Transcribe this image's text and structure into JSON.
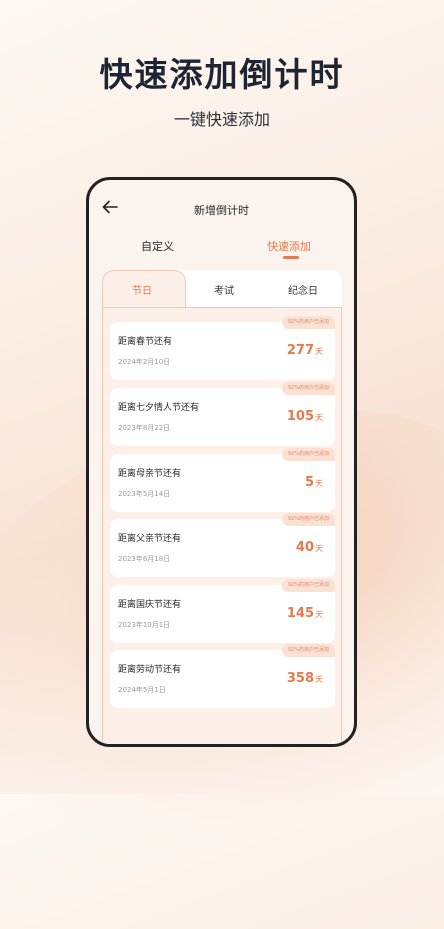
{
  "headline": "快速添加倒计时",
  "subhead": "一键快速添加",
  "nav": {
    "title": "新增倒计时",
    "back_icon": "arrow-left-icon"
  },
  "mode_tabs": [
    {
      "label": "自定义",
      "active": false
    },
    {
      "label": "快速添加",
      "active": true
    }
  ],
  "category_tabs": [
    {
      "label": "节日",
      "active": true
    },
    {
      "label": "考试",
      "active": false
    },
    {
      "label": "纪念日",
      "active": false
    }
  ],
  "items": [
    {
      "title": "距离春节还有",
      "date": "2024年2月10日",
      "days": "277",
      "unit": "天",
      "badge": "92%的用户已添加"
    },
    {
      "title": "距离七夕情人节还有",
      "date": "2023年8月22日",
      "days": "105",
      "unit": "天",
      "badge": "92%的用户已添加"
    },
    {
      "title": "距离母亲节还有",
      "date": "2023年5月14日",
      "days": "5",
      "unit": "天",
      "badge": "92%的用户已添加"
    },
    {
      "title": "距离父亲节还有",
      "date": "2023年6月18日",
      "days": "40",
      "unit": "天",
      "badge": "92%的用户已添加"
    },
    {
      "title": "距离国庆节还有",
      "date": "2023年10月1日",
      "days": "145",
      "unit": "天",
      "badge": "92%的用户已添加"
    },
    {
      "title": "距离劳动节还有",
      "date": "2024年5月1日",
      "days": "358",
      "unit": "天",
      "badge": "92%的用户已添加"
    }
  ],
  "colors": {
    "accent": "#e57a4e",
    "badge_bg": "#fbe1d4",
    "panel_tint": "#fdf0e8"
  }
}
